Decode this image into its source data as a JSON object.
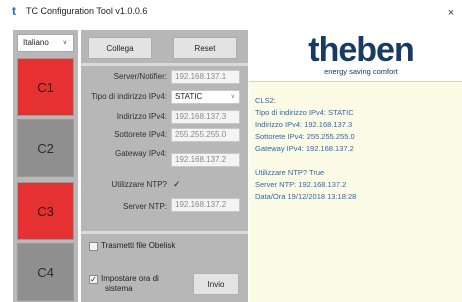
{
  "window": {
    "title": "TC Configuration Tool v1.0.0.6",
    "app_icon_glyph": "t",
    "close_glyph": "×"
  },
  "sidebar": {
    "language": "Italiano",
    "channels": [
      {
        "label": "C1",
        "state": "red"
      },
      {
        "label": "C2",
        "state": "gray"
      },
      {
        "label": "C3",
        "state": "red"
      },
      {
        "label": "C4",
        "state": "gray"
      }
    ]
  },
  "toolbar": {
    "connect_label": "Collega",
    "reset_label": "Reset"
  },
  "network": {
    "server_label": "Server/Notifier:",
    "server_value": "192.168.137.1",
    "ip_type_label": "Tipo di indirizzo IPv4:",
    "ip_type_value": "STATIC",
    "ip_label": "Indirizzo IPv4:",
    "ip_value": "192.168.137.3",
    "subnet_label": "Sottorete IPv4:",
    "subnet_value": "255.255.255.0",
    "gateway_label": "Gateway IPv4:",
    "gateway_value": "192.168.137.2",
    "ntp_label": "Utilizzare NTP?",
    "ntp_checked": "✓",
    "ntp_server_label": "Server NTP:",
    "ntp_server_value": "192.168.137.2"
  },
  "actions": {
    "obelisk_label": "Trasmetti file Obelisk",
    "obelisk_checked": "",
    "set_time_label_1": "Impostare ora di",
    "set_time_label_2": "sistema",
    "set_time_checked": "✓",
    "send_label": "Invio"
  },
  "brand": {
    "logo_text": "theben",
    "tagline": "energy saving comfort",
    "colors": {
      "logo": "#173a66",
      "info_text": "#2f66b3",
      "channel_active": "#e53131"
    }
  },
  "info": {
    "lines": [
      "CLS2:",
      "Tipo di indirizzo IPv4: STATIC",
      "Indirizzo IPv4: 192.168.137.3",
      "Sottorete IPv4: 255.255.255.0",
      "Gateway IPv4: 192.168.137.2",
      "",
      "Utilizzare NTP? True",
      "Server NTP: 192.168.137.2",
      "Data/Ora 19/12/2018 13:18:28"
    ]
  }
}
